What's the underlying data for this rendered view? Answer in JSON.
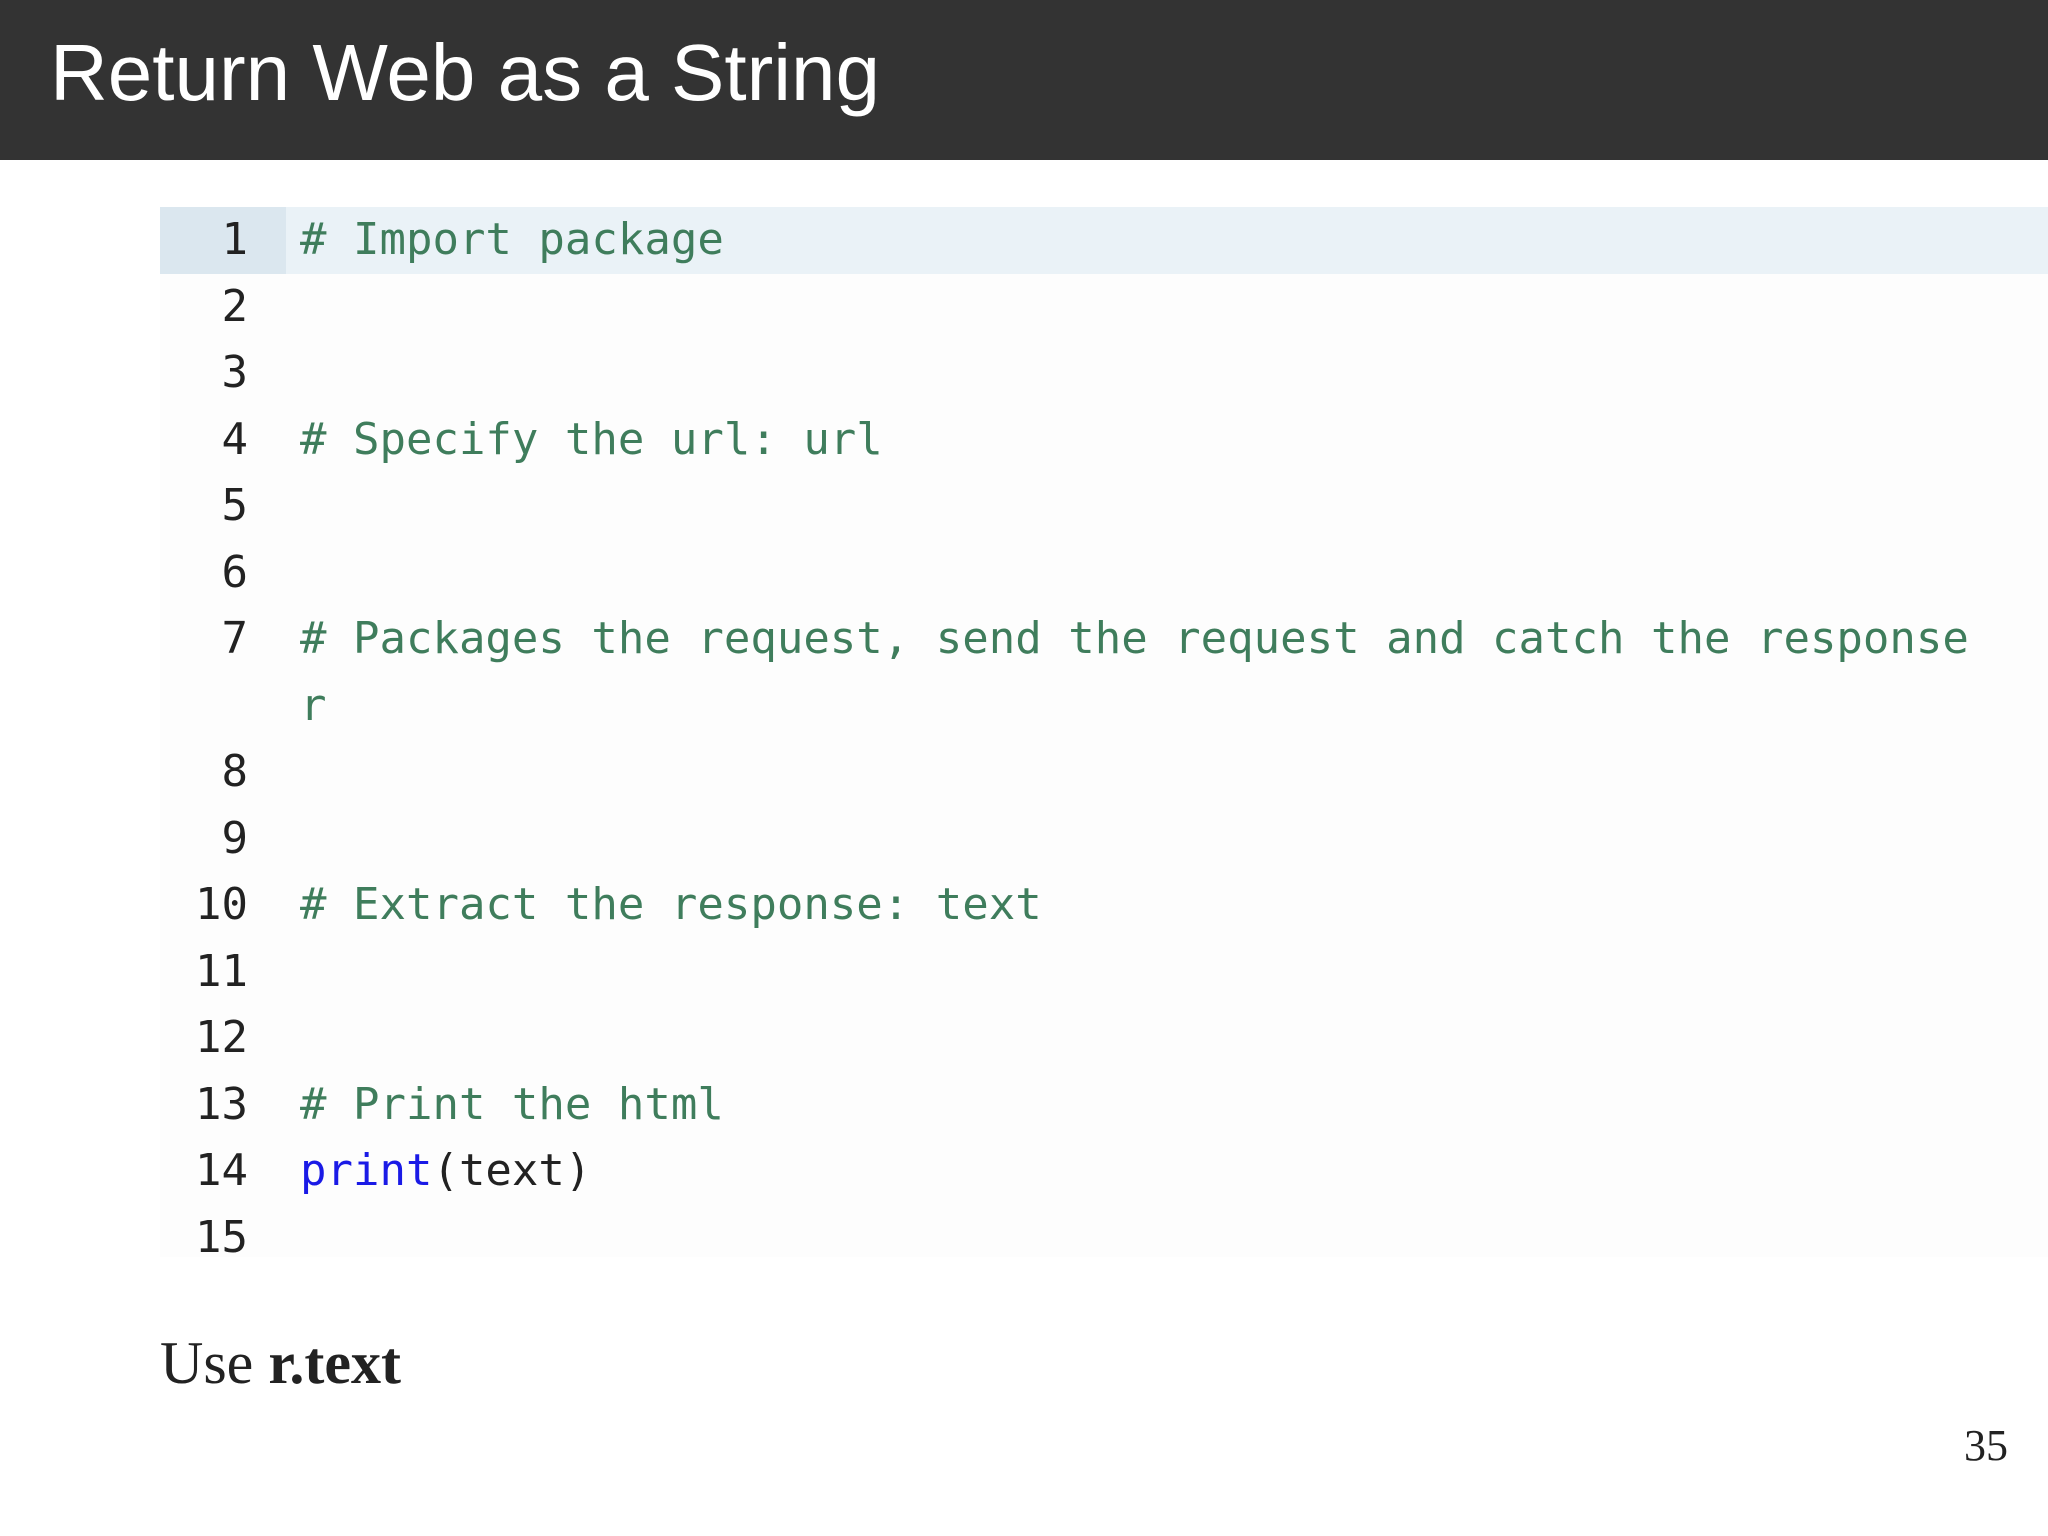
{
  "slide": {
    "title": "Return Web as a String",
    "page_number": "35"
  },
  "code": {
    "lines": [
      {
        "n": "1",
        "tokens": [
          {
            "t": "# Import package",
            "k": "comment"
          }
        ]
      },
      {
        "n": "2",
        "tokens": []
      },
      {
        "n": "3",
        "tokens": []
      },
      {
        "n": "4",
        "tokens": [
          {
            "t": "# Specify the url: url",
            "k": "comment"
          }
        ]
      },
      {
        "n": "5",
        "tokens": []
      },
      {
        "n": "6",
        "tokens": []
      },
      {
        "n": "7",
        "tokens": [
          {
            "t": "# Packages the request, send the request and catch the response",
            "k": "comment"
          }
        ]
      },
      {
        "n": "",
        "tokens": [
          {
            "t": "r",
            "k": "comment"
          }
        ]
      },
      {
        "n": "8",
        "tokens": []
      },
      {
        "n": "9",
        "tokens": []
      },
      {
        "n": "10",
        "tokens": [
          {
            "t": "# Extract the response: text",
            "k": "comment"
          }
        ]
      },
      {
        "n": "11",
        "tokens": []
      },
      {
        "n": "12",
        "tokens": []
      },
      {
        "n": "13",
        "tokens": [
          {
            "t": "# Print the html",
            "k": "comment"
          }
        ]
      },
      {
        "n": "14",
        "tokens": [
          {
            "t": "print",
            "k": "builtin"
          },
          {
            "t": "(text)",
            "k": "plain"
          }
        ]
      },
      {
        "n": "15",
        "tokens": []
      }
    ]
  },
  "caption": {
    "prefix": "Use ",
    "bold": "r.text"
  }
}
